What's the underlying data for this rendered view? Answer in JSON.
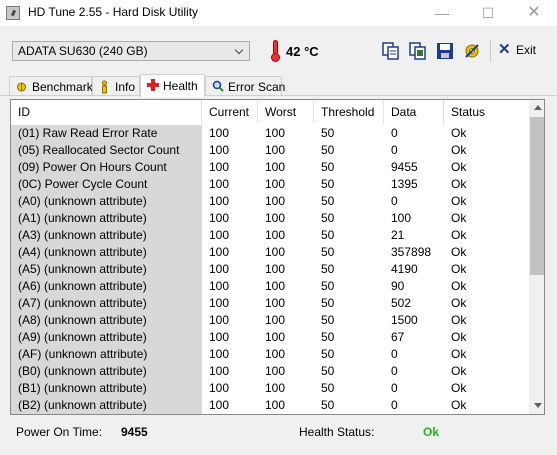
{
  "window": {
    "title": "HD Tune 2.55 - Hard Disk Utility",
    "minimize": "—",
    "maximize": "☐",
    "close": "✕"
  },
  "toolbar": {
    "drive": "ADATA   SU630 (240 GB)",
    "temperature": "42 °C",
    "exit_label": "Exit"
  },
  "tabs": [
    {
      "label": "Benchmark",
      "icon": "benchmark-icon"
    },
    {
      "label": "Info",
      "icon": "info-icon"
    },
    {
      "label": "Health",
      "icon": "health-cross-icon",
      "active": true
    },
    {
      "label": "Error Scan",
      "icon": "magnifier-icon"
    }
  ],
  "table": {
    "columns": [
      "ID",
      "Current",
      "Worst",
      "Threshold",
      "Data",
      "Status"
    ],
    "rows": [
      [
        "(01) Raw Read Error Rate",
        "100",
        "100",
        "50",
        "0",
        "Ok"
      ],
      [
        "(05) Reallocated Sector Count",
        "100",
        "100",
        "50",
        "0",
        "Ok"
      ],
      [
        "(09) Power On Hours Count",
        "100",
        "100",
        "50",
        "9455",
        "Ok"
      ],
      [
        "(0C) Power Cycle Count",
        "100",
        "100",
        "50",
        "1395",
        "Ok"
      ],
      [
        "(A0) (unknown attribute)",
        "100",
        "100",
        "50",
        "0",
        "Ok"
      ],
      [
        "(A1) (unknown attribute)",
        "100",
        "100",
        "50",
        "100",
        "Ok"
      ],
      [
        "(A3) (unknown attribute)",
        "100",
        "100",
        "50",
        "21",
        "Ok"
      ],
      [
        "(A4) (unknown attribute)",
        "100",
        "100",
        "50",
        "357898",
        "Ok"
      ],
      [
        "(A5) (unknown attribute)",
        "100",
        "100",
        "50",
        "4190",
        "Ok"
      ],
      [
        "(A6) (unknown attribute)",
        "100",
        "100",
        "50",
        "90",
        "Ok"
      ],
      [
        "(A7) (unknown attribute)",
        "100",
        "100",
        "50",
        "502",
        "Ok"
      ],
      [
        "(A8) (unknown attribute)",
        "100",
        "100",
        "50",
        "1500",
        "Ok"
      ],
      [
        "(A9) (unknown attribute)",
        "100",
        "100",
        "50",
        "67",
        "Ok"
      ],
      [
        "(AF) (unknown attribute)",
        "100",
        "100",
        "50",
        "0",
        "Ok"
      ],
      [
        "(B0) (unknown attribute)",
        "100",
        "100",
        "50",
        "0",
        "Ok"
      ],
      [
        "(B1) (unknown attribute)",
        "100",
        "100",
        "50",
        "0",
        "Ok"
      ],
      [
        "(B2) (unknown attribute)",
        "100",
        "100",
        "50",
        "0",
        "Ok"
      ]
    ]
  },
  "status": {
    "power_on_label": "Power On Time:",
    "power_on_value": "9455",
    "health_label": "Health Status:",
    "health_value": "Ok",
    "health_color": "#22b51e"
  }
}
